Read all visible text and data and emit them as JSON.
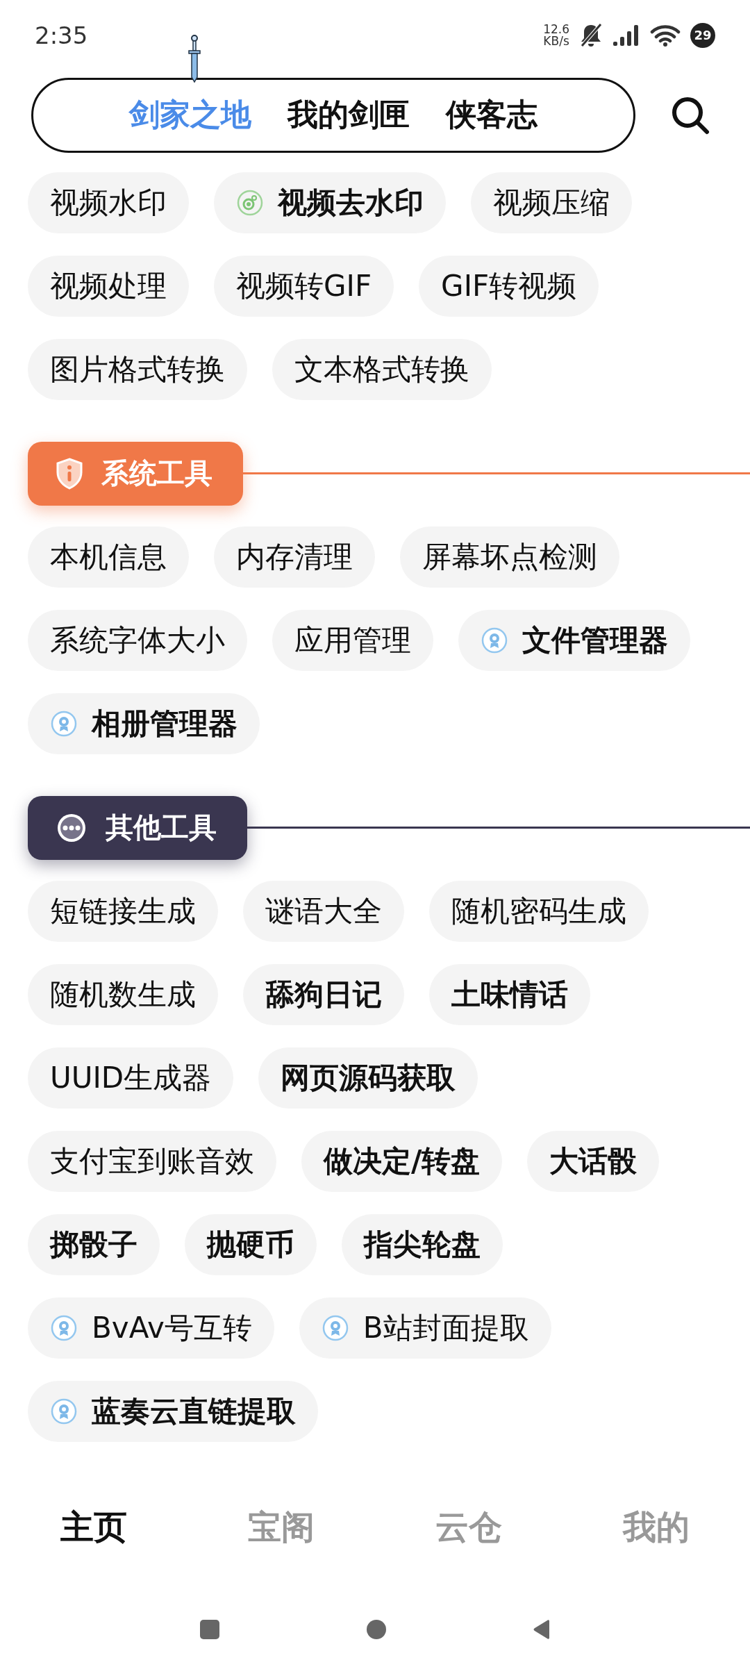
{
  "status_bar": {
    "time": "2:35",
    "speed_value": "12.6",
    "speed_unit": "KB/s",
    "battery": "29"
  },
  "tabs": [
    {
      "label": "剑家之地",
      "selected": true
    },
    {
      "label": "我的剑匣",
      "selected": false
    },
    {
      "label": "侠客志",
      "selected": false
    }
  ],
  "sections": [
    {
      "kind": "plain",
      "chips": [
        {
          "label": "视频水印",
          "bold": false,
          "kind": "plain"
        },
        {
          "label": "视频去水印",
          "bold": true,
          "kind": "target"
        },
        {
          "label": "视频压缩",
          "bold": false,
          "kind": "plain"
        },
        {
          "label": "视频处理",
          "bold": false,
          "kind": "plain"
        },
        {
          "label": "视频转GIF",
          "bold": false,
          "kind": "plain"
        },
        {
          "label": "GIF转视频",
          "bold": false,
          "kind": "plain"
        },
        {
          "label": "图片格式转换",
          "bold": false,
          "kind": "plain"
        },
        {
          "label": "文本格式转换",
          "bold": false,
          "kind": "plain"
        }
      ]
    },
    {
      "kind": "info",
      "title": "系统工具",
      "color": "#f07848",
      "chips": [
        {
          "label": "本机信息",
          "bold": false,
          "kind": "plain"
        },
        {
          "label": "内存清理",
          "bold": false,
          "kind": "plain"
        },
        {
          "label": "屏幕坏点检测",
          "bold": false,
          "kind": "plain"
        },
        {
          "label": "系统字体大小",
          "bold": false,
          "kind": "plain"
        },
        {
          "label": "应用管理",
          "bold": false,
          "kind": "plain"
        },
        {
          "label": "文件管理器",
          "bold": true,
          "kind": "badge"
        },
        {
          "label": "相册管理器",
          "bold": true,
          "kind": "badge"
        }
      ]
    },
    {
      "kind": "more",
      "title": "其他工具",
      "color": "#3a3650",
      "chips": [
        {
          "label": "短链接生成",
          "bold": false,
          "kind": "plain"
        },
        {
          "label": "谜语大全",
          "bold": false,
          "kind": "plain"
        },
        {
          "label": "随机密码生成",
          "bold": false,
          "kind": "plain"
        },
        {
          "label": "随机数生成",
          "bold": false,
          "kind": "plain"
        },
        {
          "label": "舔狗日记",
          "bold": true,
          "kind": "plain"
        },
        {
          "label": "土味情话",
          "bold": true,
          "kind": "plain"
        },
        {
          "label": "UUID生成器",
          "bold": false,
          "kind": "plain"
        },
        {
          "label": "网页源码获取",
          "bold": true,
          "kind": "plain"
        },
        {
          "label": "支付宝到账音效",
          "bold": false,
          "kind": "plain"
        },
        {
          "label": "做决定/转盘",
          "bold": true,
          "kind": "plain"
        },
        {
          "label": "大话骰",
          "bold": true,
          "kind": "plain"
        },
        {
          "label": "掷骰子",
          "bold": true,
          "kind": "plain"
        },
        {
          "label": "抛硬币",
          "bold": true,
          "kind": "plain"
        },
        {
          "label": "指尖轮盘",
          "bold": true,
          "kind": "plain"
        },
        {
          "label": "BvAv号互转",
          "bold": false,
          "kind": "badge"
        },
        {
          "label": "B站封面提取",
          "bold": false,
          "kind": "badge"
        },
        {
          "label": "蓝奏云直链提取",
          "bold": true,
          "kind": "badge"
        }
      ]
    }
  ],
  "bottom_nav": [
    {
      "label": "主页",
      "selected": true
    },
    {
      "label": "宝阁",
      "selected": false
    },
    {
      "label": "云仓",
      "selected": false
    },
    {
      "label": "我的",
      "selected": false
    }
  ]
}
